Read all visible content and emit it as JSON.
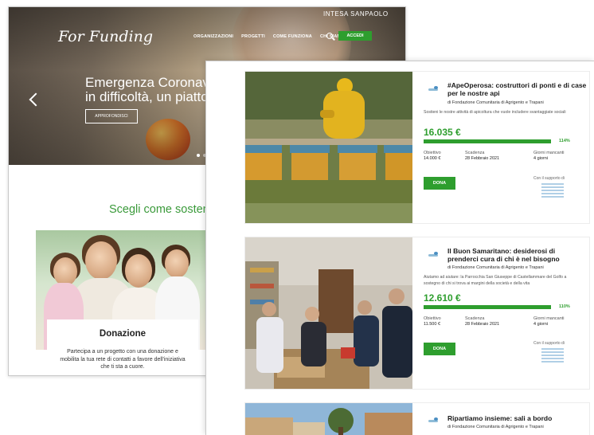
{
  "back_window": {
    "brand_bank": "INTESA SANPAOLO",
    "logo": "For Funding",
    "nav": [
      "ORGANIZZAZIONI",
      "PROGETTI",
      "COME FUNZIONA",
      "CHI SIAMO"
    ],
    "access_label": "ACCEDI",
    "hero_title": "Emergenza Coronaviru\nin difficoltà, un piatto a",
    "hero_button": "APPROFONDISCI",
    "section_title": "Scegli come sostenere",
    "card_title": "Donazione",
    "card_desc": "Partecipa a un progetto con una donazione e mobilita la tua rete di contatti a favore dell'iniziativa che ti sta a cuore."
  },
  "projects": [
    {
      "title": "#ApeOperosa: costruttori di ponti e di case per le nostre api",
      "org": "di Fondazione Comunitaria di Agrigento e Trapani",
      "description": "Sostieni le nostre attività di apicoltura che vuole includere svantaggiate sociali",
      "amount": "16.035 €",
      "progress": 1.0,
      "percent": "114%",
      "goal_label": "Obiettivo",
      "goal": "14.000 €",
      "deadline_label": "Scadenza",
      "deadline": "28 Febbraio 2021",
      "days_label": "Giorni mancanti",
      "days": "4 giorni",
      "donate": "DONA",
      "support": "Con il supporto di"
    },
    {
      "title": "Il Buon Samaritano: desiderosi di prenderci cura di chi è nel bisogno",
      "org": "di Fondazione Comunitaria di Agrigento e Trapani",
      "description": "Aiutamo ad aiutare: la Parrocchia San Giuseppe di Castellammare del Golfo a sostegno di chi si trova ai margini della società e della vita",
      "amount": "12.610 €",
      "progress": 1.0,
      "percent": "110%",
      "goal_label": "Obiettivo",
      "goal": "11.500 €",
      "deadline_label": "Scadenza",
      "deadline": "28 Febbraio 2021",
      "days_label": "Giorni mancanti",
      "days": "4 giorni",
      "donate": "DONA",
      "support": "Con il supporto di"
    },
    {
      "title": "Ripartiamo insieme: sali a bordo",
      "org": "di Fondazione Comunitaria di Agrigento e Trapani"
    }
  ],
  "colors": {
    "accent_green": "#2e9e2e",
    "section_green": "#3a9a3a"
  }
}
